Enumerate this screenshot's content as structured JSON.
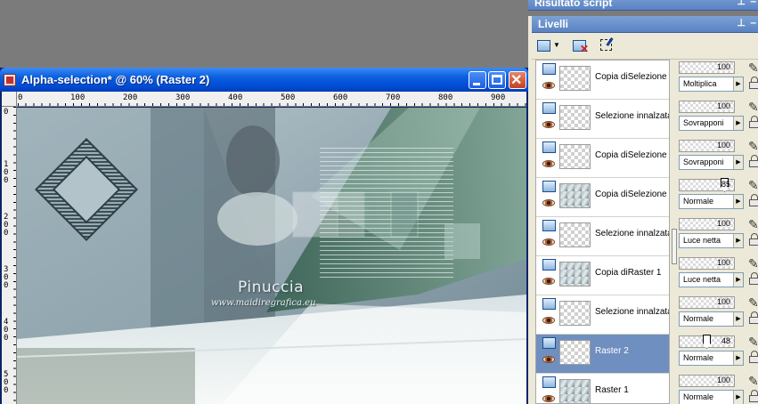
{
  "document": {
    "title": "Alpha-selection* @  60% (Raster 2)",
    "ruler_top_labels": [
      "0",
      "100",
      "200",
      "300",
      "400",
      "500",
      "600",
      "700",
      "800",
      "900"
    ],
    "ruler_left_labels": [
      "0",
      "100",
      "200",
      "300",
      "400",
      "500"
    ],
    "watermark": "Pinuccia",
    "watermark_url": "www.maidiregrafica.eu"
  },
  "script_palette": {
    "title": "Risultato script"
  },
  "layers_palette": {
    "title": "Livelli",
    "toolbar": {
      "new_layer_icon": "new-raster-layer-icon",
      "delete_icon": "delete-layer-icon",
      "mask_icon": "mask-selection-icon"
    },
    "layers": [
      {
        "name": "Copia diSelezione",
        "opacity": 100,
        "blend": "Moltiplica",
        "thumb": "checker",
        "selected": false
      },
      {
        "name": "Selezione innalzata",
        "opacity": 100,
        "blend": "Sovrapponi",
        "thumb": "checker",
        "selected": false
      },
      {
        "name": "Copia diSelezione",
        "opacity": 100,
        "blend": "Sovrapponi",
        "thumb": "checker",
        "selected": false
      },
      {
        "name": "Copia diSelezione",
        "opacity": 85,
        "blend": "Normale",
        "thumb": "rich",
        "selected": false
      },
      {
        "name": "Selezione innalzata",
        "opacity": 100,
        "blend": "Luce netta",
        "thumb": "checker",
        "selected": false
      },
      {
        "name": "Copia diRaster 1",
        "opacity": 100,
        "blend": "Luce netta",
        "thumb": "rich",
        "selected": false
      },
      {
        "name": "Selezione innalzata",
        "opacity": 100,
        "blend": "Normale",
        "thumb": "checker",
        "selected": false
      },
      {
        "name": "Raster 2",
        "opacity": 48,
        "blend": "Normale",
        "thumb": "checker",
        "selected": true
      },
      {
        "name": "Raster 1",
        "opacity": 100,
        "blend": "Normale",
        "thumb": "rich",
        "selected": false
      }
    ]
  },
  "colors": {
    "selection": "#6f8fc0",
    "titlebar": "#0a5fe0",
    "palette_header": "#6b93cc"
  }
}
